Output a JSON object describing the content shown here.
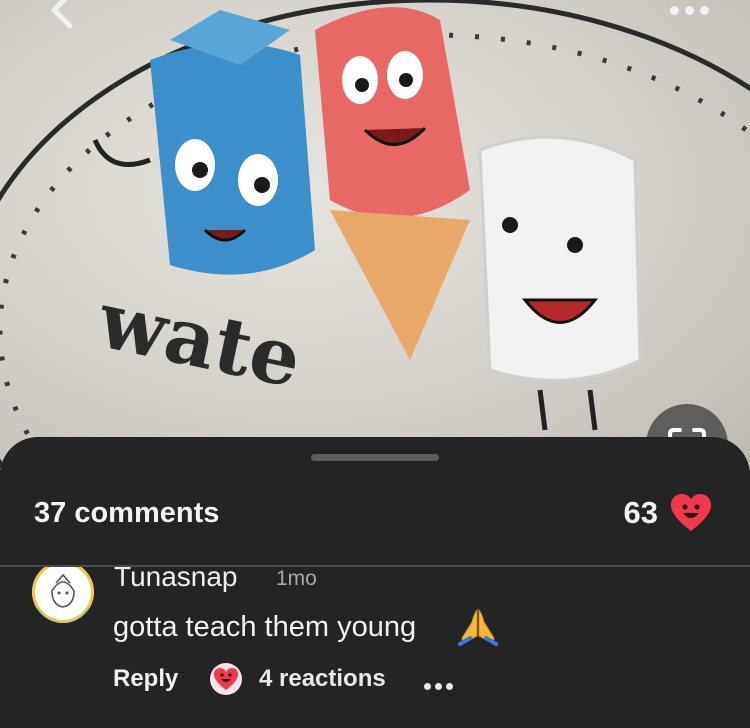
{
  "media": {
    "sign_text": "wate",
    "icons": [
      "back-icon",
      "more-icon",
      "scan-icon"
    ]
  },
  "comments_sheet": {
    "count_label": "37 comments",
    "likes_count": "63",
    "like_icon": "heart-face-icon",
    "accent": "#f1384c"
  },
  "comment": {
    "author": "Tunasnap",
    "time": "1mo",
    "text": "gotta teach them young",
    "emoji_icon": "folded-hands-icon",
    "reply_label": "Reply",
    "reactions_label": "4 reactions"
  }
}
